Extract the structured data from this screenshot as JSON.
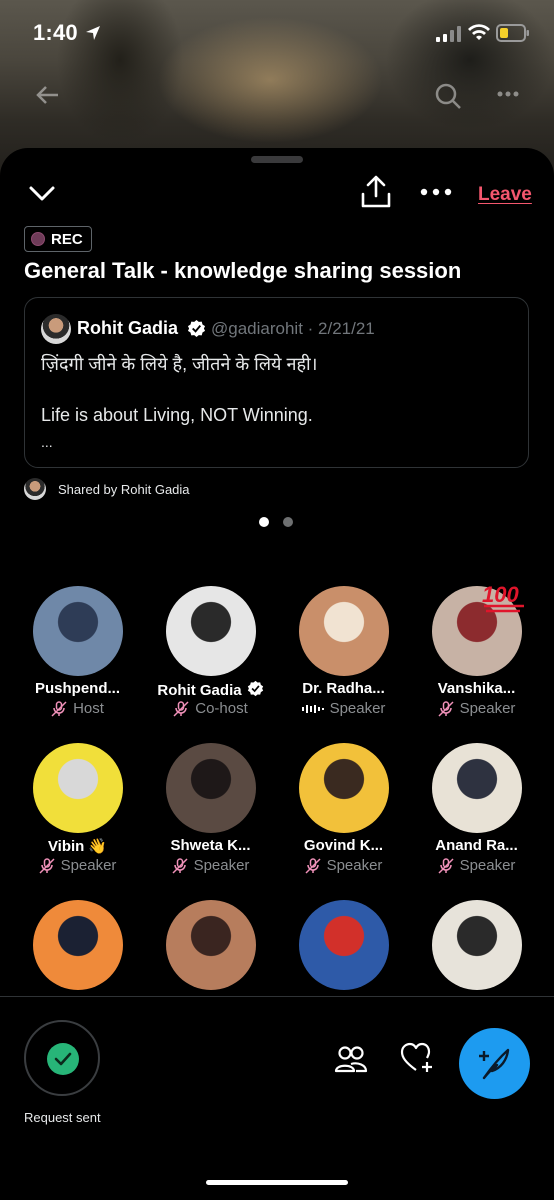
{
  "status_bar": {
    "time": "1:40"
  },
  "header": {
    "leave_label": "Leave",
    "rec_label": "REC",
    "title": "General Talk - knowledge sharing session"
  },
  "tweet": {
    "author": "Rohit Gadia",
    "handle": "@gadiarohit · 2/21/21",
    "line1": "ज़िंदगी जीने के लिये है, जीतने के लिये नही।",
    "line2": "Life is about Living, NOT Winning.",
    "line3": "..."
  },
  "shared_by": "Shared by Rohit Gadia",
  "pager": {
    "pages": 2,
    "active": 1
  },
  "participants": [
    {
      "name": "Pushpend...",
      "role": "Host",
      "mic": "muted",
      "colors": [
        "#6f88a8",
        "#2e3c56"
      ]
    },
    {
      "name": "Rohit Gadia",
      "role": "Co-host",
      "mic": "muted",
      "colors": [
        "#e6e6e6",
        "#2a2a2a"
      ]
    },
    {
      "name": "Dr. Radha...",
      "role": "Speaker",
      "mic": "speaking",
      "colors": [
        "#c98f6a",
        "#f1e3d2"
      ]
    },
    {
      "name": "Vanshika...",
      "role": "Speaker",
      "mic": "muted",
      "colors": [
        "#c7b2a5",
        "#8c2b2e"
      ]
    },
    {
      "name": "Vibin",
      "emoji": "👋",
      "role": "Speaker",
      "mic": "muted",
      "colors": [
        "#f1df3a",
        "#d8d8d8"
      ]
    },
    {
      "name": "Shweta K...",
      "role": "Speaker",
      "mic": "muted",
      "colors": [
        "#5a4a42",
        "#1e1818"
      ]
    },
    {
      "name": "Govind K...",
      "role": "Speaker",
      "mic": "muted",
      "colors": [
        "#f2c13a",
        "#3a2a20"
      ]
    },
    {
      "name": "Anand Ra...",
      "role": "Speaker",
      "mic": "muted",
      "colors": [
        "#e8e2d6",
        "#2e3240"
      ]
    },
    {
      "name": "",
      "role": "",
      "mic": "",
      "colors": [
        "#ef8a3a",
        "#1b2133"
      ]
    },
    {
      "name": "",
      "role": "",
      "mic": "",
      "colors": [
        "#b77d5d",
        "#3a2520"
      ]
    },
    {
      "name": "",
      "role": "",
      "mic": "",
      "colors": [
        "#2e5aa8",
        "#d2302a"
      ]
    },
    {
      "name": "",
      "role": "",
      "mic": "",
      "colors": [
        "#e7e3da",
        "#2a2a2a"
      ]
    }
  ],
  "bottom": {
    "request_label": "Request sent"
  }
}
